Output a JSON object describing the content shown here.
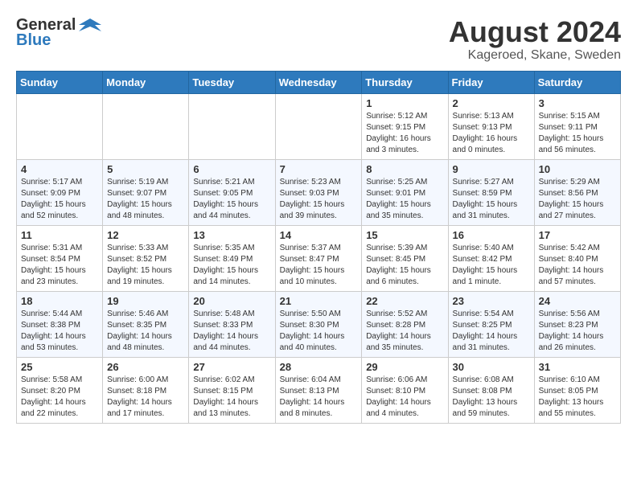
{
  "header": {
    "logo_general": "General",
    "logo_blue": "Blue",
    "month_year": "August 2024",
    "location": "Kageroed, Skane, Sweden"
  },
  "weekdays": [
    "Sunday",
    "Monday",
    "Tuesday",
    "Wednesday",
    "Thursday",
    "Friday",
    "Saturday"
  ],
  "weeks": [
    [
      {
        "day": "",
        "info": ""
      },
      {
        "day": "",
        "info": ""
      },
      {
        "day": "",
        "info": ""
      },
      {
        "day": "",
        "info": ""
      },
      {
        "day": "1",
        "info": "Sunrise: 5:12 AM\nSunset: 9:15 PM\nDaylight: 16 hours\nand 3 minutes."
      },
      {
        "day": "2",
        "info": "Sunrise: 5:13 AM\nSunset: 9:13 PM\nDaylight: 16 hours\nand 0 minutes."
      },
      {
        "day": "3",
        "info": "Sunrise: 5:15 AM\nSunset: 9:11 PM\nDaylight: 15 hours\nand 56 minutes."
      }
    ],
    [
      {
        "day": "4",
        "info": "Sunrise: 5:17 AM\nSunset: 9:09 PM\nDaylight: 15 hours\nand 52 minutes."
      },
      {
        "day": "5",
        "info": "Sunrise: 5:19 AM\nSunset: 9:07 PM\nDaylight: 15 hours\nand 48 minutes."
      },
      {
        "day": "6",
        "info": "Sunrise: 5:21 AM\nSunset: 9:05 PM\nDaylight: 15 hours\nand 44 minutes."
      },
      {
        "day": "7",
        "info": "Sunrise: 5:23 AM\nSunset: 9:03 PM\nDaylight: 15 hours\nand 39 minutes."
      },
      {
        "day": "8",
        "info": "Sunrise: 5:25 AM\nSunset: 9:01 PM\nDaylight: 15 hours\nand 35 minutes."
      },
      {
        "day": "9",
        "info": "Sunrise: 5:27 AM\nSunset: 8:59 PM\nDaylight: 15 hours\nand 31 minutes."
      },
      {
        "day": "10",
        "info": "Sunrise: 5:29 AM\nSunset: 8:56 PM\nDaylight: 15 hours\nand 27 minutes."
      }
    ],
    [
      {
        "day": "11",
        "info": "Sunrise: 5:31 AM\nSunset: 8:54 PM\nDaylight: 15 hours\nand 23 minutes."
      },
      {
        "day": "12",
        "info": "Sunrise: 5:33 AM\nSunset: 8:52 PM\nDaylight: 15 hours\nand 19 minutes."
      },
      {
        "day": "13",
        "info": "Sunrise: 5:35 AM\nSunset: 8:49 PM\nDaylight: 15 hours\nand 14 minutes."
      },
      {
        "day": "14",
        "info": "Sunrise: 5:37 AM\nSunset: 8:47 PM\nDaylight: 15 hours\nand 10 minutes."
      },
      {
        "day": "15",
        "info": "Sunrise: 5:39 AM\nSunset: 8:45 PM\nDaylight: 15 hours\nand 6 minutes."
      },
      {
        "day": "16",
        "info": "Sunrise: 5:40 AM\nSunset: 8:42 PM\nDaylight: 15 hours\nand 1 minute."
      },
      {
        "day": "17",
        "info": "Sunrise: 5:42 AM\nSunset: 8:40 PM\nDaylight: 14 hours\nand 57 minutes."
      }
    ],
    [
      {
        "day": "18",
        "info": "Sunrise: 5:44 AM\nSunset: 8:38 PM\nDaylight: 14 hours\nand 53 minutes."
      },
      {
        "day": "19",
        "info": "Sunrise: 5:46 AM\nSunset: 8:35 PM\nDaylight: 14 hours\nand 48 minutes."
      },
      {
        "day": "20",
        "info": "Sunrise: 5:48 AM\nSunset: 8:33 PM\nDaylight: 14 hours\nand 44 minutes."
      },
      {
        "day": "21",
        "info": "Sunrise: 5:50 AM\nSunset: 8:30 PM\nDaylight: 14 hours\nand 40 minutes."
      },
      {
        "day": "22",
        "info": "Sunrise: 5:52 AM\nSunset: 8:28 PM\nDaylight: 14 hours\nand 35 minutes."
      },
      {
        "day": "23",
        "info": "Sunrise: 5:54 AM\nSunset: 8:25 PM\nDaylight: 14 hours\nand 31 minutes."
      },
      {
        "day": "24",
        "info": "Sunrise: 5:56 AM\nSunset: 8:23 PM\nDaylight: 14 hours\nand 26 minutes."
      }
    ],
    [
      {
        "day": "25",
        "info": "Sunrise: 5:58 AM\nSunset: 8:20 PM\nDaylight: 14 hours\nand 22 minutes."
      },
      {
        "day": "26",
        "info": "Sunrise: 6:00 AM\nSunset: 8:18 PM\nDaylight: 14 hours\nand 17 minutes."
      },
      {
        "day": "27",
        "info": "Sunrise: 6:02 AM\nSunset: 8:15 PM\nDaylight: 14 hours\nand 13 minutes."
      },
      {
        "day": "28",
        "info": "Sunrise: 6:04 AM\nSunset: 8:13 PM\nDaylight: 14 hours\nand 8 minutes."
      },
      {
        "day": "29",
        "info": "Sunrise: 6:06 AM\nSunset: 8:10 PM\nDaylight: 14 hours\nand 4 minutes."
      },
      {
        "day": "30",
        "info": "Sunrise: 6:08 AM\nSunset: 8:08 PM\nDaylight: 13 hours\nand 59 minutes."
      },
      {
        "day": "31",
        "info": "Sunrise: 6:10 AM\nSunset: 8:05 PM\nDaylight: 13 hours\nand 55 minutes."
      }
    ]
  ]
}
